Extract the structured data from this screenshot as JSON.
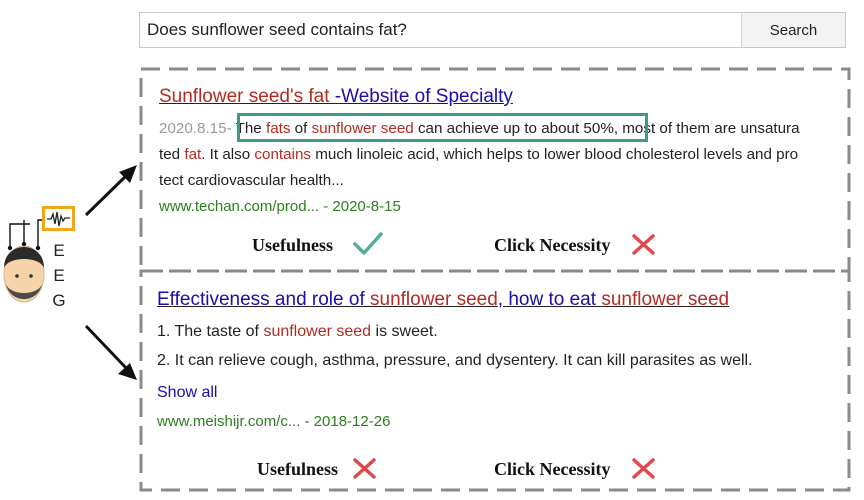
{
  "search": {
    "query": "Does sunflower seed contains fat?",
    "button_label": "Search"
  },
  "subject": {
    "eeg_letters": [
      "E",
      "E",
      "G"
    ],
    "icons": [
      "person-with-eeg-cap-icon",
      "eeg-waveform-monitor-icon",
      "arrow-icon"
    ]
  },
  "result1": {
    "title_part1": "Sunflower seed's fat",
    "title_part2": " -Website of Specialty",
    "snippet_date": "2020.8.15-",
    "snippet_line1": [
      " The ",
      "fats",
      " of ",
      "sunflower seed",
      " can achieve up to about 50%,",
      " most of them are unsatura"
    ],
    "snippet_line2": [
      "ted ",
      "fat",
      ". It also ",
      "contains",
      " much linoleic acid, which helps to lower blood cholesterol levels and pro"
    ],
    "snippet_line3": "tect cardiovascular health...",
    "url": "www.techan.com/prod... - 2020-8-15",
    "usefulness_label": "Usefulness",
    "usefulness": "check",
    "click_necessity_label": "Click Necessity",
    "click_necessity": "cross"
  },
  "result2": {
    "title_parts": [
      "Effectiveness and role of ",
      "sunflower seed",
      ", how to eat ",
      "sunflower seed"
    ],
    "item1": [
      "1. The taste of ",
      "sunflower seed",
      " is sweet."
    ],
    "item2": "2. It can relieve cough, asthma, pressure, and dysentery. It can kill parasites as well.",
    "show_all": "Show all",
    "url": "www.meishijr.com/c... - 2018-12-26",
    "usefulness_label": "Usefulness",
    "usefulness": "cross",
    "click_necessity_label": "Click Necessity",
    "click_necessity": "cross"
  },
  "colors": {
    "title_red": "#b52a22",
    "title_blue": "#1a0dab",
    "url_green": "#2d7d1e",
    "highlight_box": "#3d9b84",
    "check": "#4fae95",
    "cross": "#e0484a",
    "dashed_border": "#8a8a8a"
  }
}
